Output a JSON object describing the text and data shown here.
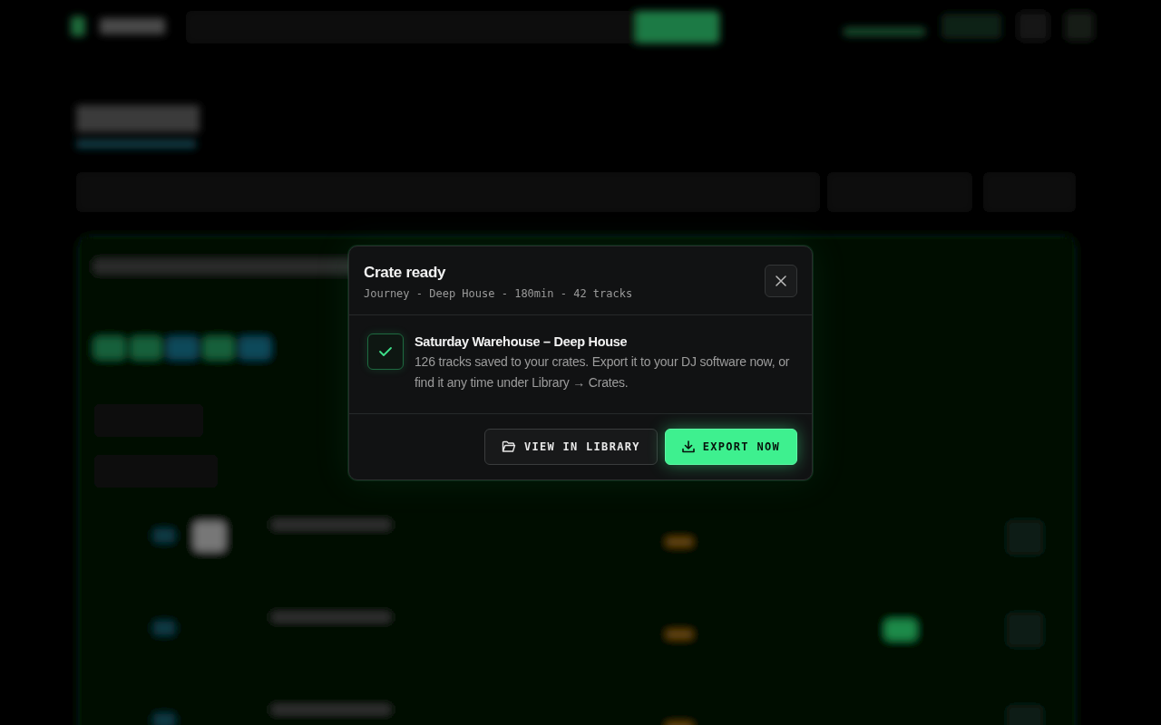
{
  "dialog": {
    "title": "Crate ready",
    "subtitle": "Journey - Deep House - 180min - 42 tracks",
    "message": {
      "title": "Saturday Warehouse – Deep House",
      "text": "126 tracks saved to your crates. Export it to your DJ software now, or find it any time under Library → Crates."
    },
    "buttons": [
      {
        "label": "VIEW IN LIBRARY",
        "kind": "secondary"
      },
      {
        "label": "EXPORT NOW",
        "kind": "primary"
      }
    ]
  }
}
